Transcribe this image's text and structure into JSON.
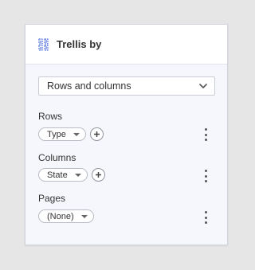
{
  "panel": {
    "title": "Trellis by",
    "icon": "trellis-icon"
  },
  "mode_dropdown": {
    "selected": "Rows and columns",
    "icon": "chevron-down-icon"
  },
  "sections": [
    {
      "label": "Rows",
      "value": "Type"
    },
    {
      "label": "Columns",
      "value": "State"
    },
    {
      "label": "Pages",
      "value": "(None)"
    }
  ],
  "colors": {
    "panel_bg": "#f5f7fc",
    "header_bg": "#ffffff",
    "icon_blue": "#3a5fd9"
  }
}
